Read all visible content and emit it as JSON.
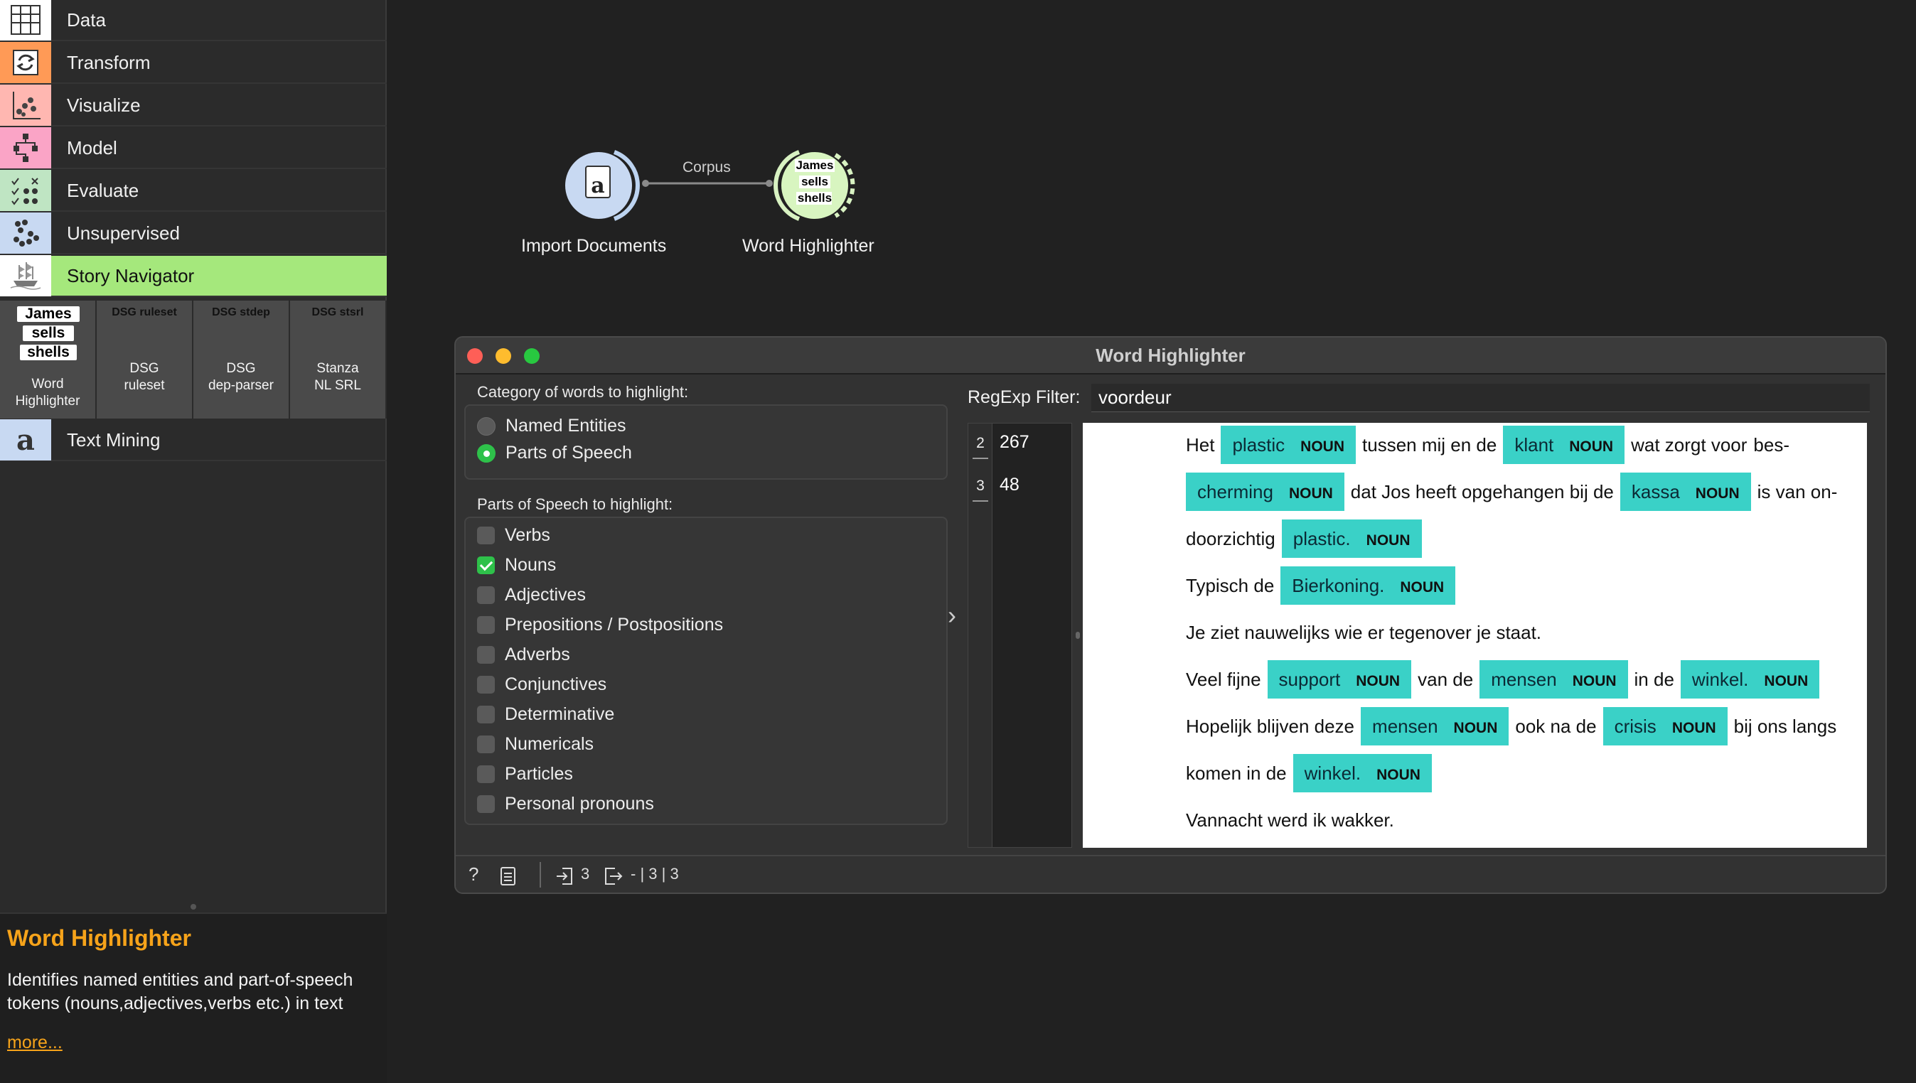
{
  "sidebar": {
    "categories": [
      {
        "label": "Data",
        "icon": "table-icon",
        "color": "#ffffff"
      },
      {
        "label": "Transform",
        "icon": "transform-icon",
        "color": "#ff9a56"
      },
      {
        "label": "Visualize",
        "icon": "scatter-icon",
        "color": "#ffb7b1"
      },
      {
        "label": "Model",
        "icon": "tree-icon",
        "color": "#faa4c6"
      },
      {
        "label": "Evaluate",
        "icon": "evaluate-icon",
        "color": "#bfe5c3"
      },
      {
        "label": "Unsupervised",
        "icon": "cluster-icon",
        "color": "#c8d9f2"
      },
      {
        "label": "Story Navigator",
        "icon": "ship-icon",
        "color": "#ffffff"
      }
    ],
    "widgets": [
      {
        "top": "",
        "name": "Word\nHighlighter",
        "icon_words": [
          "James",
          "sells",
          "shells"
        ]
      },
      {
        "top": "DSG ruleset",
        "name": "DSG\nruleset"
      },
      {
        "top": "DSG stdep",
        "name": "DSG\ndep-parser"
      },
      {
        "top": "DSG stsrl",
        "name": "Stanza\nNL SRL"
      }
    ],
    "text_mining": "Text Mining",
    "description": {
      "title": "Word Highlighter",
      "body": "Identifies named entities and part-of-speech tokens (nouns,adjectives,verbs etc.) in text",
      "more": "more..."
    }
  },
  "canvas": {
    "link_label": "Corpus",
    "nodes": [
      {
        "label": "Import Documents",
        "icon": "import-documents-icon"
      },
      {
        "label": "Word Highlighter",
        "icon": "word-highlighter-icon",
        "icon_words": [
          "James",
          "sells",
          "shells"
        ]
      }
    ]
  },
  "dialog": {
    "title": "Word Highlighter",
    "category_title": "Category of words to highlight:",
    "categories": [
      {
        "label": "Named Entities",
        "checked": false
      },
      {
        "label": "Parts of Speech",
        "checked": true
      }
    ],
    "pos_title": "Parts of Speech to highlight:",
    "pos": [
      {
        "label": "Verbs",
        "checked": false
      },
      {
        "label": "Nouns",
        "checked": true
      },
      {
        "label": "Adjectives",
        "checked": false
      },
      {
        "label": "Prepositions / Postpositions",
        "checked": false
      },
      {
        "label": "Adverbs",
        "checked": false
      },
      {
        "label": "Conjunctives",
        "checked": false
      },
      {
        "label": "Determinative",
        "checked": false
      },
      {
        "label": "Numericals",
        "checked": false
      },
      {
        "label": "Particles",
        "checked": false
      },
      {
        "label": "Personal pronouns",
        "checked": false
      }
    ],
    "filter_label": "RegExp Filter:",
    "filter_value": "voordeur",
    "rows": [
      {
        "index": "2",
        "value": "267"
      },
      {
        "index": "3",
        "value": "48"
      }
    ],
    "document_lines": [
      [
        {
          "t": "Het"
        },
        {
          "t": "plastic",
          "tag": "NOUN"
        },
        {
          "t": "tussen mij en de"
        },
        {
          "t": "klant",
          "tag": "NOUN"
        },
        {
          "t": "wat zorgt voor"
        },
        {
          "t": "bes-"
        }
      ],
      [
        {
          "t": "cherming",
          "tag": "NOUN"
        },
        {
          "t": "dat Jos heeft opgehangen bij de"
        },
        {
          "t": "kassa",
          "tag": "NOUN"
        },
        {
          "t": "is van on-"
        }
      ],
      [
        {
          "t": "doorzichtig"
        },
        {
          "t": "plastic.",
          "tag": "NOUN"
        }
      ],
      [
        {
          "t": "Typisch de"
        },
        {
          "t": "Bierkoning.",
          "tag": "NOUN"
        }
      ],
      [
        {
          "t": "Je ziet nauwelijks wie er tegenover je staat."
        }
      ],
      [
        {
          "t": "Veel fijne"
        },
        {
          "t": "support",
          "tag": "NOUN"
        },
        {
          "t": "van de"
        },
        {
          "t": "mensen",
          "tag": "NOUN"
        },
        {
          "t": "in de"
        },
        {
          "t": "winkel.",
          "tag": "NOUN"
        }
      ],
      [
        {
          "t": "Hopelijk blijven deze"
        },
        {
          "t": "mensen",
          "tag": "NOUN"
        },
        {
          "t": "ook na de"
        },
        {
          "t": "crisis",
          "tag": "NOUN"
        },
        {
          "t": "bij ons langs"
        }
      ],
      [
        {
          "t": "komen in de"
        },
        {
          "t": "winkel.",
          "tag": "NOUN"
        }
      ],
      [
        {
          "t": "Vannacht werd ik wakker."
        }
      ]
    ],
    "status": {
      "input_count": "3",
      "output": "- | 3 | 3"
    },
    "highlight_color": "#3ad1c7"
  }
}
